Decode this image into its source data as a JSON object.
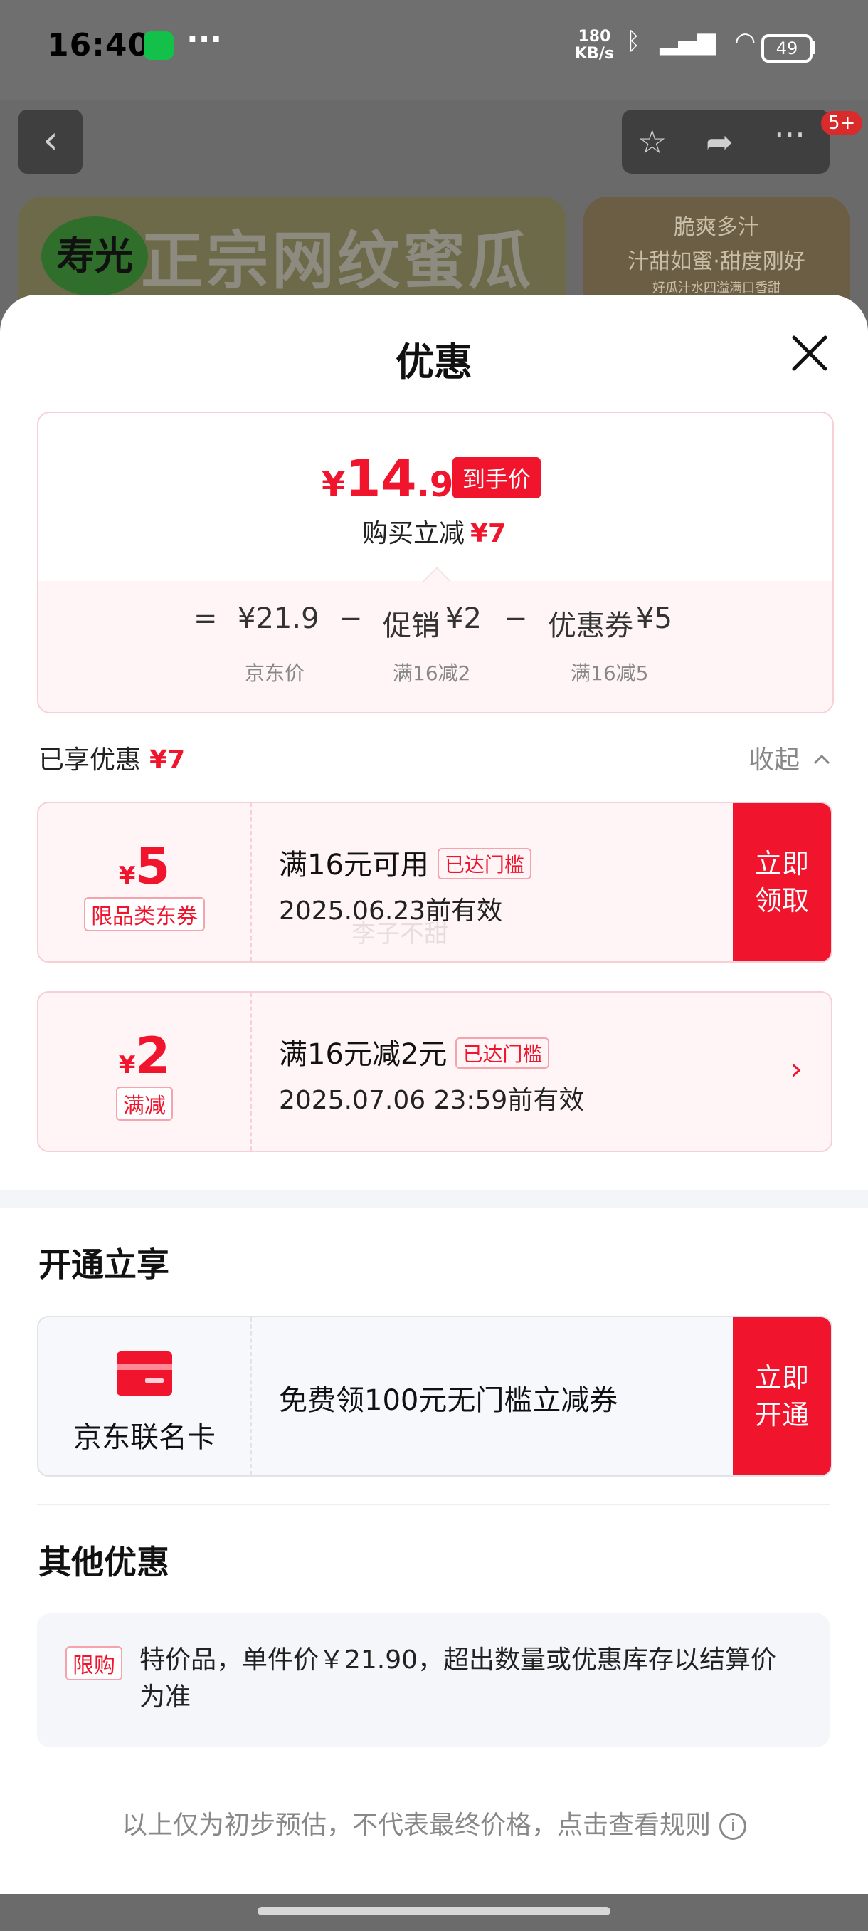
{
  "status_bar": {
    "time": "16:40",
    "dots": "···",
    "net_speed_value": "180",
    "net_speed_unit": "KB/s",
    "battery": "49"
  },
  "background_page": {
    "banner_logo": "寿光",
    "banner_title": "正宗网纹蜜瓜",
    "banner2_line1": "脆爽多汁",
    "banner2_line2": "汁甜如蜜·甜度刚好",
    "banner2_line3": "好瓜汁水四溢满口香甜",
    "cart_badge": "5+"
  },
  "sheet": {
    "title": "优惠"
  },
  "price_summary": {
    "currency": "¥",
    "final_int": "14",
    "final_dec": ".9",
    "final_tag": "到手价",
    "reduce_label": "购买立减",
    "reduce_amount": "¥7",
    "formula": {
      "equals": "=",
      "base_price": "¥21.9",
      "minus1": "−",
      "promo_label": "促销",
      "promo_amount": "¥2",
      "minus2": "−",
      "coupon_label": "优惠券",
      "coupon_amount": "¥5"
    },
    "sub_labels": {
      "base": "京东价",
      "promo": "满16减2",
      "coupon": "满16减5"
    }
  },
  "enjoyed": {
    "label": "已享优惠",
    "amount": "¥7",
    "collapse": "收起"
  },
  "coupons": [
    {
      "currency": "¥",
      "amount": "5",
      "kind": "限品类东券",
      "condition": "满16元可用",
      "reached": "已达门槛",
      "valid": "2025.06.23前有效",
      "cta": "立即领取"
    },
    {
      "currency": "¥",
      "amount": "2",
      "kind": "满减",
      "condition": "满16元减2元",
      "reached": "已达门槛",
      "valid": "2025.07.06 23:59前有效",
      "arrow": "›"
    }
  ],
  "watermark": "李子不甜",
  "open_section": {
    "title": "开通立享",
    "card_name": "京东联名卡",
    "card_text": "免费领100元无门槛立减券",
    "cta": "立即开通"
  },
  "other_section": {
    "title": "其他优惠",
    "tag": "限购",
    "text": "特价品，单件价￥21.90，超出数量或优惠库存以结算价为准"
  },
  "footer": {
    "note": "以上仅为初步预估，不代表最终价格，点击查看规则",
    "info_icon": "i"
  },
  "colors": {
    "accent": "#f0142d",
    "coupon_bg": "#fff5f6",
    "coupon_border": "#f6d0d4"
  }
}
